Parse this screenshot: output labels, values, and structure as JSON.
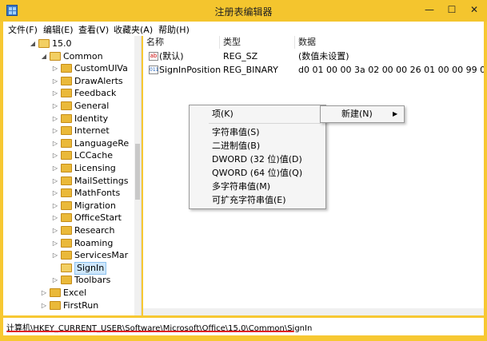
{
  "window": {
    "title": "注册表编辑器",
    "controls": [
      "—",
      "☐",
      "✕"
    ]
  },
  "menu": [
    "文件(F)",
    "编辑(E)",
    "查看(V)",
    "收藏夹(A)",
    "帮助(H)"
  ],
  "tree": [
    {
      "label": "15.0",
      "indent": 0,
      "expander": "◢",
      "open": true
    },
    {
      "label": "Common",
      "indent": 1,
      "expander": "◢",
      "open": true
    },
    {
      "label": "CustomUIVa",
      "indent": 2,
      "expander": "▷"
    },
    {
      "label": "DrawAlerts",
      "indent": 2,
      "expander": "▷"
    },
    {
      "label": "Feedback",
      "indent": 2,
      "expander": "▷"
    },
    {
      "label": "General",
      "indent": 2,
      "expander": "▷"
    },
    {
      "label": "Identity",
      "indent": 2,
      "expander": "▷"
    },
    {
      "label": "Internet",
      "indent": 2,
      "expander": "▷"
    },
    {
      "label": "LanguageRe",
      "indent": 2,
      "expander": "▷"
    },
    {
      "label": "LCCache",
      "indent": 2,
      "expander": "▷"
    },
    {
      "label": "Licensing",
      "indent": 2,
      "expander": "▷"
    },
    {
      "label": "MailSettings",
      "indent": 2,
      "expander": "▷"
    },
    {
      "label": "MathFonts",
      "indent": 2,
      "expander": "▷"
    },
    {
      "label": "Migration",
      "indent": 2,
      "expander": "▷"
    },
    {
      "label": "OfficeStart",
      "indent": 2,
      "expander": "▷"
    },
    {
      "label": "Research",
      "indent": 2,
      "expander": "▷"
    },
    {
      "label": "Roaming",
      "indent": 2,
      "expander": "▷"
    },
    {
      "label": "ServicesMar",
      "indent": 2,
      "expander": "▷"
    },
    {
      "label": "SignIn",
      "indent": 2,
      "expander": "",
      "selected": true,
      "open": true
    },
    {
      "label": "Toolbars",
      "indent": 2,
      "expander": "▷"
    },
    {
      "label": "Excel",
      "indent": 1,
      "expander": "▷"
    },
    {
      "label": "FirstRun",
      "indent": 1,
      "expander": "▷"
    }
  ],
  "list": {
    "headers": [
      "名称",
      "类型",
      "数据"
    ],
    "rows": [
      {
        "icon": "ab",
        "name": "(默认)",
        "type": "REG_SZ",
        "data": "(数值未设置)"
      },
      {
        "icon": "011",
        "name": "SignInPosition",
        "type": "REG_BINARY",
        "data": "d0 01 00 00 3a 02 00 00 26 01 00 00 99 00 00..."
      }
    ]
  },
  "context_menu": {
    "items": [
      "项(K)",
      "字符串值(S)",
      "二进制值(B)",
      "DWORD (32 位)值(D)",
      "QWORD (64 位)值(Q)",
      "多字符串值(M)",
      "可扩充字符串值(E)"
    ],
    "new_label": "新建(N)",
    "arrow": "▶"
  },
  "status": {
    "path": "计算机\\HKEY_CURRENT_USER\\Software\\Microsoft\\Office\\15.0\\Common\\SignIn"
  },
  "colors": {
    "titlebar": "#f4c52e",
    "selection": "#cde6fb",
    "underline": "#e02020"
  }
}
